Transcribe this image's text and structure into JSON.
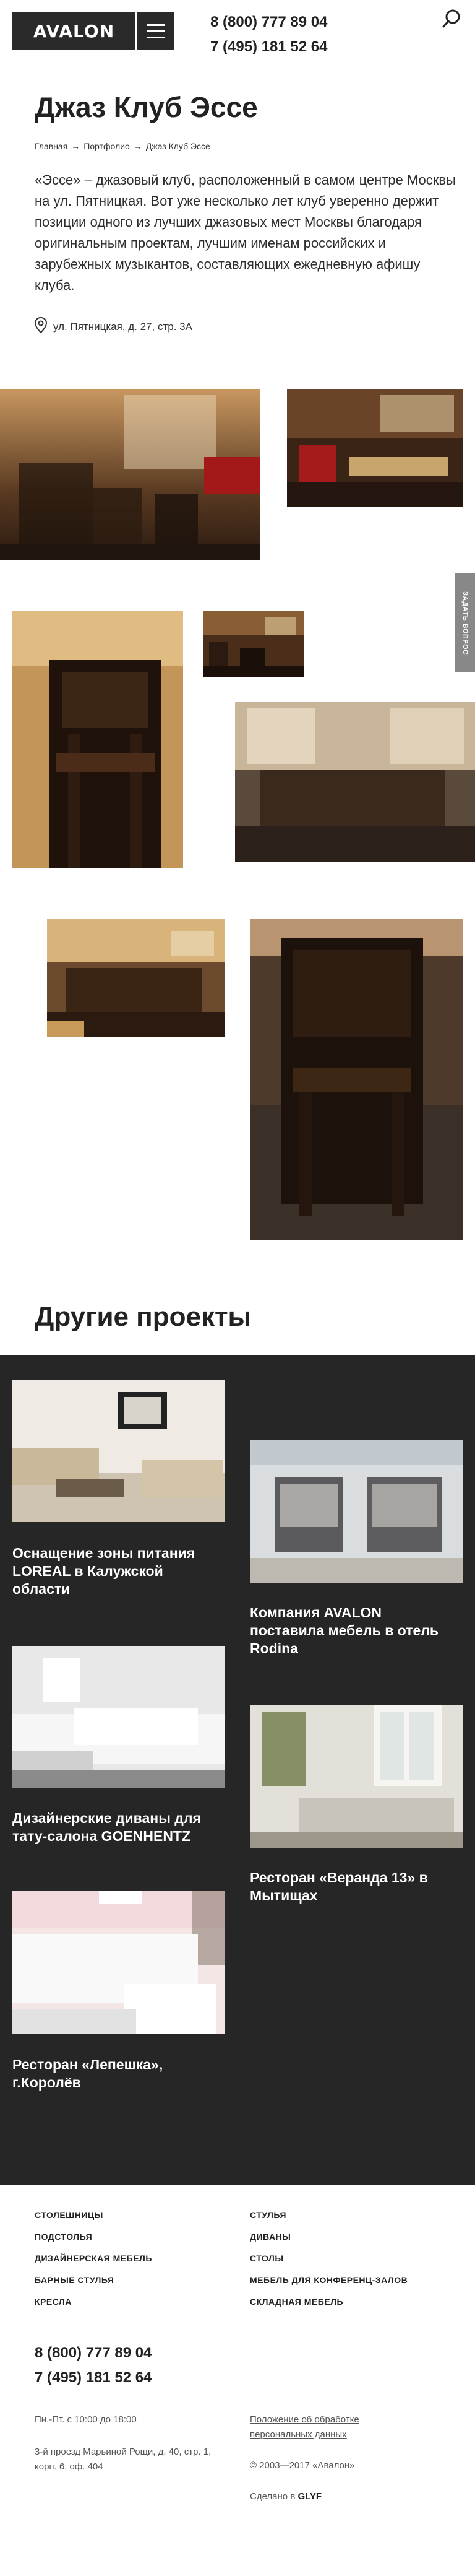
{
  "header": {
    "logo_text": "AVALON",
    "phone_1": "8 (800) 777 89 04",
    "phone_2": "7 (495) 181 52 64",
    "menu_icon": "hamburger-icon",
    "search_icon": "search-icon"
  },
  "page": {
    "title": "Джаз Клуб Эссе",
    "breadcrumb": [
      "Главная",
      "Портфолио",
      "Джаз Клуб Эссе"
    ],
    "breadcrumb_separator": "→",
    "description": "«Эссе» – джазовый клуб, расположенный в самом центре Москвы на ул. Пятницкая. Вот уже несколько лет клуб уверенно держит позиции одного из лучших джазовых мест Москвы благодаря оригинальным проектам, лучшим именам российских и зарубежных музыкантов, составляющих ежедневную афишу клуба.",
    "address": "ул. Пятницкая, д. 27, стр. 3А"
  },
  "side_tab": {
    "label": "ЗАДАТЬ ВОПРОС"
  },
  "other_projects": {
    "heading": "Другие проекты",
    "cards": [
      {
        "title": "Оснащение зоны питания LOREAL в Калужской области"
      },
      {
        "title": "Компания AVALON поставила мебель в отель Rodina"
      },
      {
        "title": "Дизайнерские диваны для тату-салона GOENHENTZ"
      },
      {
        "title": "Ресторан «Веранда 13» в Мытищах"
      },
      {
        "title": "Ресторан «Лепешка», г.Королёв"
      }
    ]
  },
  "footer": {
    "links_left": [
      "СТОЛЕШНИЦЫ",
      "ПОДСТОЛЬЯ",
      "ДИЗАЙНЕРСКАЯ МЕБЕЛЬ",
      "БАРНЫЕ СТУЛЬЯ",
      "КРЕСЛА"
    ],
    "links_right": [
      "СТУЛЬЯ",
      "ДИВАНЫ",
      "СТОЛЫ",
      "МЕБЕЛЬ ДЛЯ КОНФЕРЕНЦ-ЗАЛОВ",
      "СКЛАДНАЯ МЕБЕЛЬ"
    ],
    "phone_1": "8 (800) 777 89 04",
    "phone_2": "7 (495) 181 52 64",
    "hours": "Пн.-Пт. с 10:00 до 18:00",
    "address": "3-й проезд Марьиной Рощи, д. 40, стр. 1, корп. 6, оф. 404",
    "privacy_link": "Положение об обработке персональных данных",
    "copyright": "© 2003—2017 «Авалон»",
    "made_by_prefix": "Сделано в",
    "made_by": "GLYF"
  },
  "colors": {
    "dark_bg": "#262626",
    "side_tab": "#888888",
    "text": "#222222"
  }
}
